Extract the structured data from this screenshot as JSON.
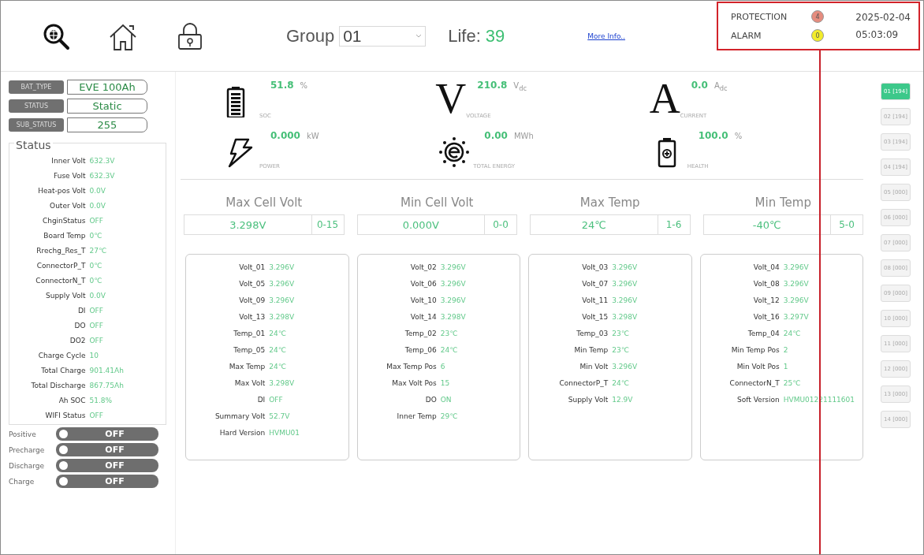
{
  "toolbar": {
    "icons": [
      {
        "kind": "search"
      },
      {
        "kind": "home"
      },
      {
        "kind": "lock"
      }
    ],
    "group_label": "Group",
    "group_value": "01",
    "life_label": "Life:",
    "life_value": "39",
    "more_info": "More Info.."
  },
  "status_panel": {
    "indicators": [
      {
        "label": "PROTECTION",
        "count": "4",
        "color": "#e58c7e"
      },
      {
        "label": "ALARM",
        "count": "0",
        "color": "#f2ec2a"
      }
    ],
    "date": "2025-02-04",
    "time": "05:03:09"
  },
  "info_tags": [
    {
      "label": "BAT_TYPE",
      "value": "EVE 100Ah"
    },
    {
      "label": "STATUS",
      "value": "Static"
    },
    {
      "label": "SUB_STATUS",
      "value": "255"
    }
  ],
  "status": {
    "title": "Status",
    "rows": [
      {
        "label": "Inner Volt",
        "value": "632.3V"
      },
      {
        "label": "Fuse Volt",
        "value": "632.3V"
      },
      {
        "label": "Heat-pos Volt",
        "value": "0.0V"
      },
      {
        "label": "Outer Volt",
        "value": "0.0V"
      },
      {
        "label": "ChginStatus",
        "value": "OFF"
      },
      {
        "label": "Board Temp",
        "value": "0℃"
      },
      {
        "label": "Rrechg_Res_T",
        "value": "27℃"
      },
      {
        "label": "ConnectorP_T",
        "value": "0℃"
      },
      {
        "label": "ConnectorN_T",
        "value": "0℃"
      },
      {
        "label": "Supply Volt",
        "value": "0.0V"
      },
      {
        "label": "DI",
        "value": "OFF"
      },
      {
        "label": "DO",
        "value": "OFF"
      },
      {
        "label": "DO2",
        "value": "OFF"
      },
      {
        "label": "Charge Cycle",
        "value": "10"
      },
      {
        "label": "Total Charge",
        "value": "901.41Ah"
      },
      {
        "label": "Total Discharge",
        "value": "867.75Ah"
      },
      {
        "label": "Ah SOC",
        "value": "51.8%"
      },
      {
        "label": "WIFI Status",
        "value": "OFF"
      }
    ]
  },
  "switches": [
    {
      "label": "Positive",
      "text": "OFF",
      "on": false
    },
    {
      "label": "Precharge",
      "text": "OFF",
      "on": false
    },
    {
      "label": "Discharge",
      "text": "OFF",
      "on": false
    },
    {
      "label": "Charge",
      "text": "OFF",
      "on": false
    }
  ],
  "metrics": [
    {
      "kind": "battery",
      "value": "51.8",
      "unit": "%",
      "caption": "SOC"
    },
    {
      "kind": "letter",
      "symbol": "V",
      "value": "210.8",
      "unit": "V$_{dc}$",
      "caption": "VOLTAGE"
    },
    {
      "kind": "letter",
      "symbol": "A",
      "value": "0.0",
      "unit": "A$_{dc}$",
      "caption": "CURRENT"
    },
    {
      "kind": "bolt",
      "value": "0.000",
      "unit": "kW",
      "caption": "POWER"
    },
    {
      "kind": "energy",
      "value": "0.00",
      "unit": "MWh",
      "caption": "TOTAL ENERGY"
    },
    {
      "kind": "health",
      "value": "100.0",
      "unit": "%",
      "caption": "HEALTH"
    }
  ],
  "extremes": [
    {
      "title": "Max Cell Volt",
      "value": "3.298V",
      "position": "0-15"
    },
    {
      "title": "Min Cell Volt",
      "value": "0.000V",
      "position": "0-0"
    },
    {
      "title": "Max Temp",
      "value": "24℃",
      "position": "1-6"
    },
    {
      "title": "Min Temp",
      "value": "-40℃",
      "position": "5-0"
    }
  ],
  "cards": [
    {
      "rows": [
        {
          "label": "Volt_01",
          "value": "3.296V"
        },
        {
          "label": "Volt_05",
          "value": "3.296V"
        },
        {
          "label": "Volt_09",
          "value": "3.296V"
        },
        {
          "label": "Volt_13",
          "value": "3.298V"
        },
        {
          "label": "Temp_01",
          "value": "24℃"
        },
        {
          "label": "Temp_05",
          "value": "24℃"
        },
        {
          "label": "Max Temp",
          "value": "24℃"
        },
        {
          "label": "Max Volt",
          "value": "3.298V"
        },
        {
          "label": "DI",
          "value": "OFF"
        },
        {
          "label": "Summary Volt",
          "value": "52.7V"
        },
        {
          "label": "Hard Version",
          "value": "HVMU01"
        }
      ]
    },
    {
      "rows": [
        {
          "label": "Volt_02",
          "value": "3.296V"
        },
        {
          "label": "Volt_06",
          "value": "3.296V"
        },
        {
          "label": "Volt_10",
          "value": "3.296V"
        },
        {
          "label": "Volt_14",
          "value": "3.298V"
        },
        {
          "label": "Temp_02",
          "value": "23℃"
        },
        {
          "label": "Temp_06",
          "value": "24℃"
        },
        {
          "label": "Max Temp Pos",
          "value": "6"
        },
        {
          "label": "Max Volt Pos",
          "value": "15"
        },
        {
          "label": "DO",
          "value": "ON"
        },
        {
          "label": "Inner Temp",
          "value": "29℃"
        }
      ]
    },
    {
      "rows": [
        {
          "label": "Volt_03",
          "value": "3.296V"
        },
        {
          "label": "Volt_07",
          "value": "3.296V"
        },
        {
          "label": "Volt_11",
          "value": "3.296V"
        },
        {
          "label": "Volt_15",
          "value": "3.298V"
        },
        {
          "label": "Temp_03",
          "value": "23℃"
        },
        {
          "label": "Min Temp",
          "value": "23℃"
        },
        {
          "label": "Min Volt",
          "value": "3.296V"
        },
        {
          "label": "ConnectorP_T",
          "value": "24℃"
        },
        {
          "label": "Supply Volt",
          "value": "12.9V"
        }
      ]
    },
    {
      "rows": [
        {
          "label": "Volt_04",
          "value": "3.296V"
        },
        {
          "label": "Volt_08",
          "value": "3.296V"
        },
        {
          "label": "Volt_12",
          "value": "3.296V"
        },
        {
          "label": "Volt_16",
          "value": "3.297V"
        },
        {
          "label": "Temp_04",
          "value": "24℃"
        },
        {
          "label": "Min Temp Pos",
          "value": "2"
        },
        {
          "label": "Min Volt Pos",
          "value": "1"
        },
        {
          "label": "ConnectorN_T",
          "value": "25℃"
        },
        {
          "label": "Soft Version",
          "value": "HVMU01221111601"
        }
      ]
    }
  ],
  "groups": [
    {
      "label": "01 [194]",
      "selected": true
    },
    {
      "label": "02 [194]",
      "selected": false
    },
    {
      "label": "03 [194]",
      "selected": false
    },
    {
      "label": "04 [194]",
      "selected": false
    },
    {
      "label": "05 [000]",
      "selected": false
    },
    {
      "label": "06 [000]",
      "selected": false
    },
    {
      "label": "07 [000]",
      "selected": false
    },
    {
      "label": "08 [000]",
      "selected": false
    },
    {
      "label": "09 [000]",
      "selected": false
    },
    {
      "label": "10 [000]",
      "selected": false
    },
    {
      "label": "11 [000]",
      "selected": false
    },
    {
      "label": "12 [000]",
      "selected": false
    },
    {
      "label": "13 [000]",
      "selected": false
    },
    {
      "label": "14 [000]",
      "selected": false
    }
  ]
}
